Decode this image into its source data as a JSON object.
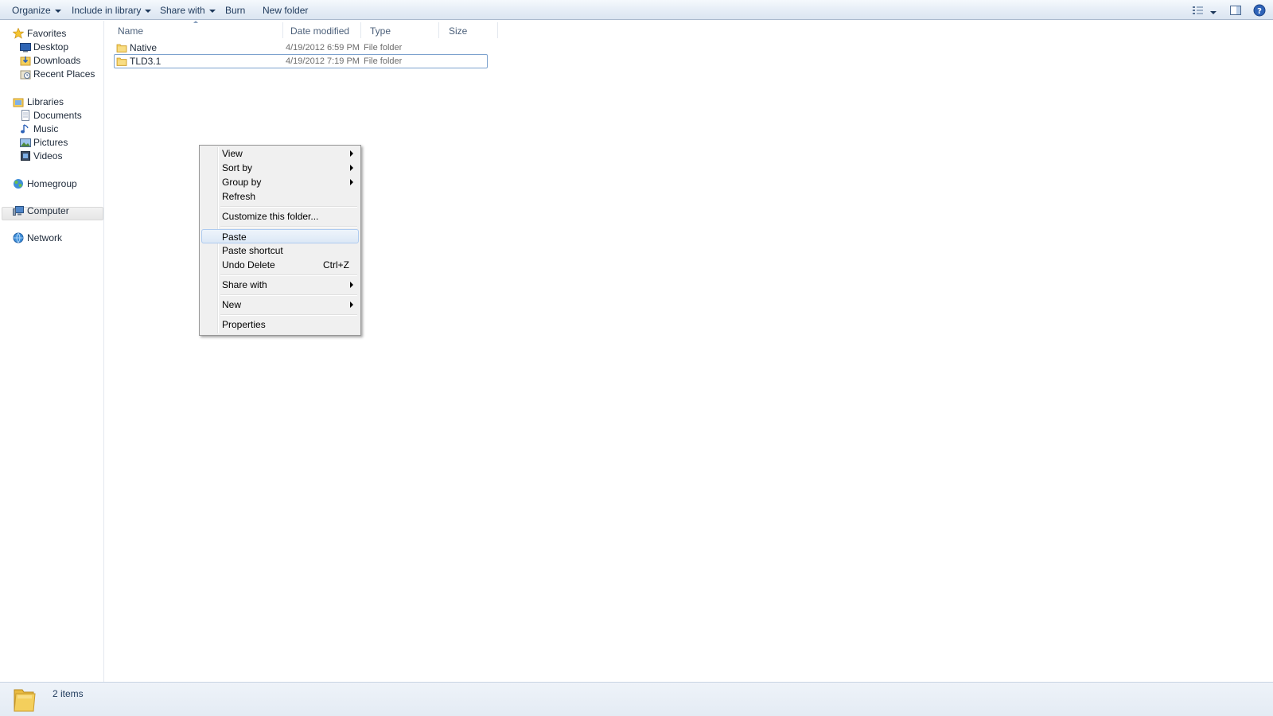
{
  "toolbar": {
    "organize": "Organize",
    "include_in_library": "Include in library",
    "share_with": "Share with",
    "burn": "Burn",
    "new_folder": "New folder",
    "right_icons": [
      "view-options-icon",
      "preview-pane-icon",
      "help-icon"
    ]
  },
  "nav": {
    "favorites": {
      "label": "Favorites",
      "icon": "star-icon",
      "items": [
        {
          "label": "Desktop",
          "icon": "desktop-icon"
        },
        {
          "label": "Downloads",
          "icon": "downloads-icon"
        },
        {
          "label": "Recent Places",
          "icon": "recent-places-icon"
        }
      ]
    },
    "libraries": {
      "label": "Libraries",
      "icon": "libraries-icon",
      "items": [
        {
          "label": "Documents",
          "icon": "documents-icon"
        },
        {
          "label": "Music",
          "icon": "music-icon"
        },
        {
          "label": "Pictures",
          "icon": "pictures-icon"
        },
        {
          "label": "Videos",
          "icon": "videos-icon"
        }
      ]
    },
    "homegroup": {
      "label": "Homegroup",
      "icon": "homegroup-icon"
    },
    "computer": {
      "label": "Computer",
      "icon": "computer-icon",
      "selected": true
    },
    "network": {
      "label": "Network",
      "icon": "network-icon"
    }
  },
  "columns": {
    "name": "Name",
    "date_modified": "Date modified",
    "type": "Type",
    "size": "Size"
  },
  "files": [
    {
      "name": "Native",
      "date": "4/19/2012 6:59 PM",
      "type": "File folder",
      "selected": false
    },
    {
      "name": "TLD3.1",
      "date": "4/19/2012 7:19 PM",
      "type": "File folder",
      "selected": true
    }
  ],
  "context_menu": {
    "view": "View",
    "sort_by": "Sort by",
    "group_by": "Group by",
    "refresh": "Refresh",
    "customize": "Customize this folder...",
    "paste": "Paste",
    "paste_shortcut": "Paste shortcut",
    "undo_delete": "Undo Delete",
    "undo_delete_shortcut": "Ctrl+Z",
    "share_with": "Share with",
    "new": "New",
    "properties": "Properties",
    "hovered": "Paste"
  },
  "details": {
    "count": "2 items",
    "icon": "folder-icon"
  },
  "colors": {
    "toolbar_text": "#1e395b",
    "selection_border": "#7da2ce",
    "menu_hover_border": "#aecbf0",
    "folder_yellow": "#f4cf5c"
  }
}
